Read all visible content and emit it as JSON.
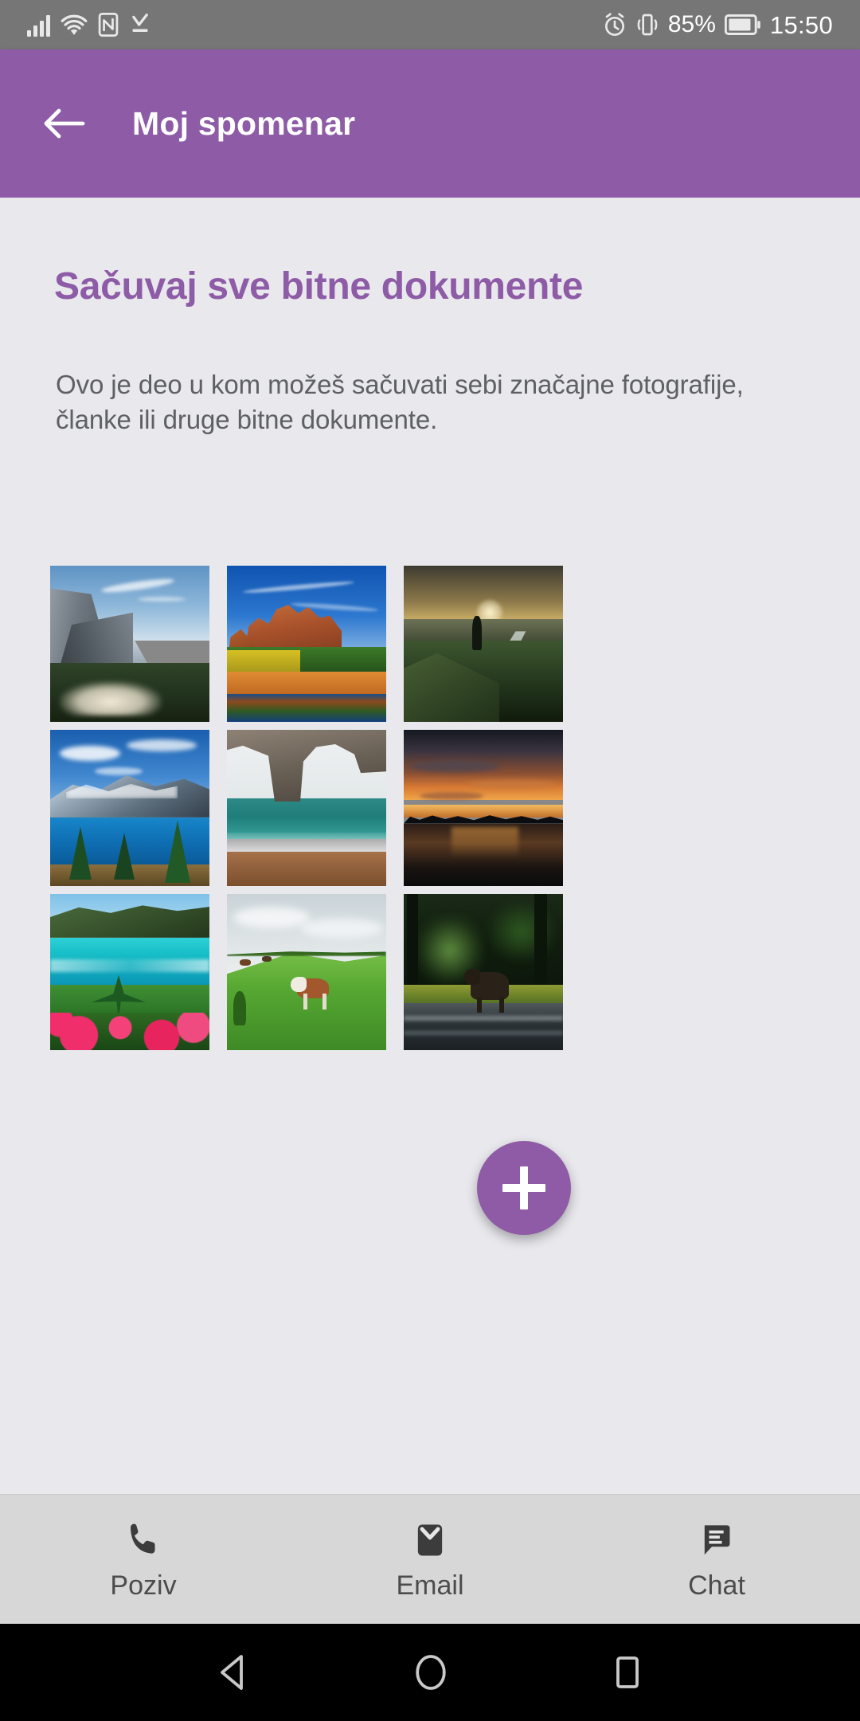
{
  "status_bar": {
    "background": "#767676",
    "icons": [
      "signal-bars-icon",
      "wifi-icon",
      "nfc-icon",
      "download-complete-icon"
    ],
    "alarm_icon": "alarm-icon",
    "vibrate_icon": "vibrate-icon",
    "battery_percent": "85%",
    "battery_icon": "battery-icon",
    "clock": "15:50"
  },
  "app_bar": {
    "background": "#8e5ba6",
    "back_icon": "arrow-left-icon",
    "title": "Moj spomenar"
  },
  "content": {
    "background": "#e8e8ed",
    "heading": "Sačuvaj sve bitne dokumente",
    "heading_color": "#8e5ba6",
    "body": "Ovo je deo u kom možeš sačuvati sebi značajne fotografije, članke ili druge bitne dokumente.",
    "body_color": "#5e6063"
  },
  "gallery": {
    "columns": 3,
    "rows": 3,
    "items": [
      {
        "id": 1,
        "name": "yosemite-valley-photo",
        "alt": "Yosemite valley with granite cliffs and mist"
      },
      {
        "id": 2,
        "name": "sedona-red-rock-photo",
        "alt": "Red rock buttes reflected in river"
      },
      {
        "id": 3,
        "name": "hiker-sunrise-ridge-photo",
        "alt": "Hiker on green ridge above braided river at sunrise"
      },
      {
        "id": 4,
        "name": "glacier-lake-photo",
        "alt": "Snow mountain above turquoise alpine lake with pines"
      },
      {
        "id": 5,
        "name": "sea-arch-beach-photo",
        "alt": "Natural rock sea arch on pebble beach"
      },
      {
        "id": 6,
        "name": "sunset-lake-photo",
        "alt": "Dark orange sunset over lake with tree silhouettes"
      },
      {
        "id": 7,
        "name": "tropical-coast-flowers-photo",
        "alt": "Turquoise tropical coast with pink flowers"
      },
      {
        "id": 8,
        "name": "cow-green-hill-photo",
        "alt": "Brown and white cow on a green pasture hill"
      },
      {
        "id": 9,
        "name": "moose-river-photo",
        "alt": "Moose standing by a river in dark forest"
      }
    ]
  },
  "fab": {
    "name": "add-button",
    "icon": "plus-icon",
    "color": "#8f5ba7"
  },
  "bottom_nav": {
    "background": "#d7d7d7",
    "items": [
      {
        "label": "Poziv",
        "icon": "phone-icon"
      },
      {
        "label": "Email",
        "icon": "envelope-icon"
      },
      {
        "label": "Chat",
        "icon": "chat-bubble-icon"
      }
    ]
  },
  "system_nav": {
    "background": "#000000",
    "items": [
      {
        "name": "android-back-button",
        "icon": "triangle-back-icon"
      },
      {
        "name": "android-home-button",
        "icon": "circle-home-icon"
      },
      {
        "name": "android-recents-button",
        "icon": "square-recents-icon"
      }
    ]
  }
}
